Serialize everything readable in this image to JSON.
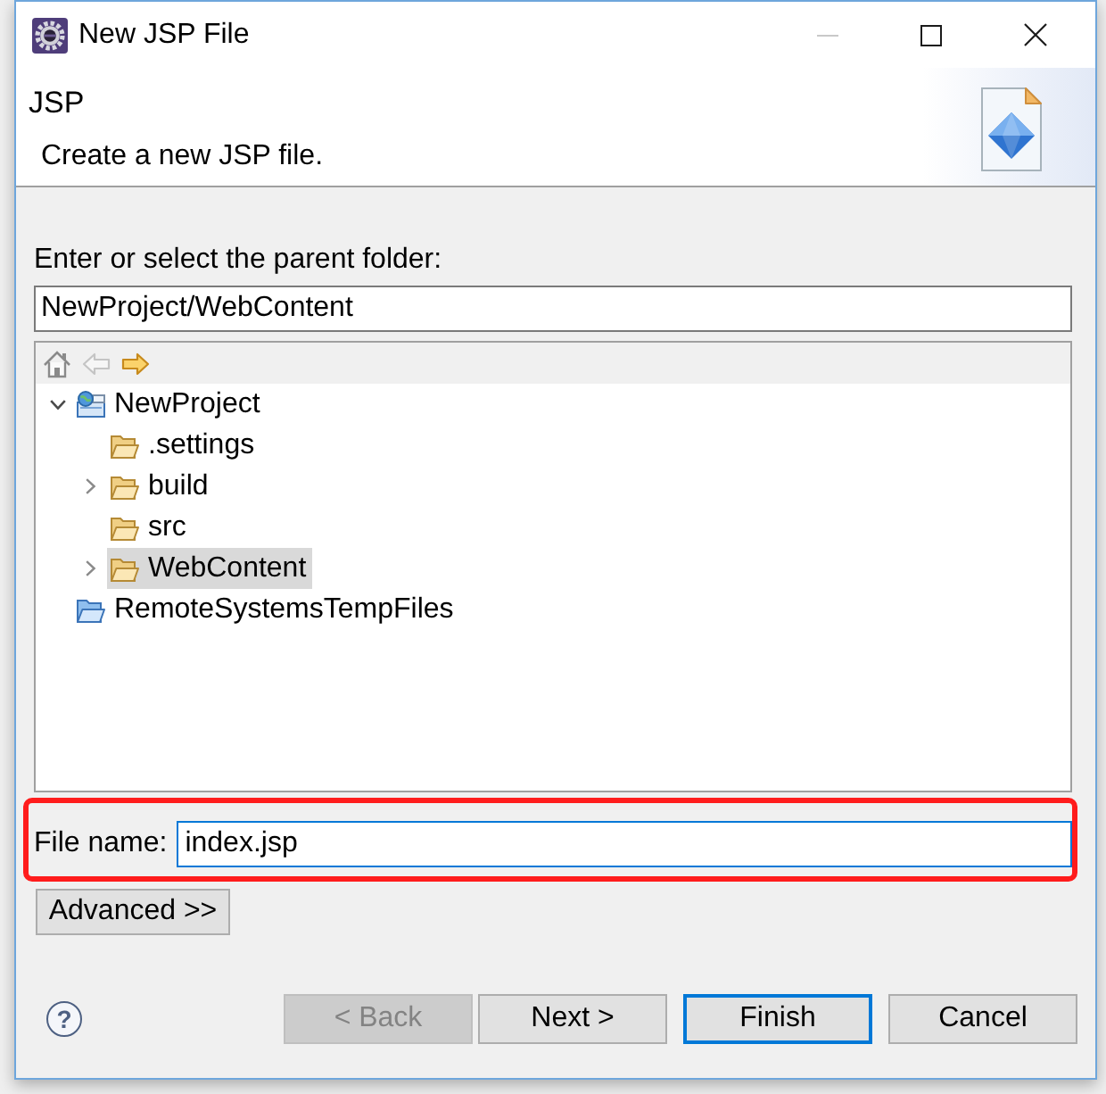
{
  "window": {
    "title": "New JSP File",
    "controls": [
      {
        "kind": "minimize",
        "disabled": true
      },
      {
        "kind": "maximize",
        "disabled": false
      },
      {
        "kind": "close",
        "disabled": false
      }
    ]
  },
  "header": {
    "title": "JSP",
    "description": "Create a new JSP file."
  },
  "parent_folder": {
    "label": "Enter or select the parent folder:",
    "value": "NewProject/WebContent",
    "focused": false
  },
  "tree_toolbar": [
    {
      "kind": "home",
      "disabled": false
    },
    {
      "kind": "back",
      "disabled": true
    },
    {
      "kind": "forward",
      "disabled": false
    }
  ],
  "tree": [
    {
      "label": "NewProject",
      "kind": "project",
      "expanded": true,
      "selected": false,
      "children": [
        {
          "label": ".settings",
          "kind": "folder",
          "selected": false
        },
        {
          "label": "build",
          "kind": "folder",
          "expanded": false,
          "selected": false
        },
        {
          "label": "src",
          "kind": "folder",
          "selected": false
        },
        {
          "label": "WebContent",
          "kind": "folder",
          "expanded": false,
          "selected": true
        }
      ]
    },
    {
      "label": "RemoteSystemsTempFiles",
      "kind": "closed_project",
      "selected": false
    }
  ],
  "file_name": {
    "label": "File name:",
    "value": "index.jsp",
    "focused": true,
    "highlighted": true
  },
  "advanced_button": {
    "label": "Advanced >>"
  },
  "help_button": {
    "symbol": "?"
  },
  "buttons": [
    {
      "label": "< Back",
      "disabled": true,
      "default": false
    },
    {
      "label": "Next >",
      "disabled": false,
      "default": false
    },
    {
      "label": "Finish",
      "disabled": false,
      "default": true
    },
    {
      "label": "Cancel",
      "disabled": false,
      "default": false
    }
  ]
}
